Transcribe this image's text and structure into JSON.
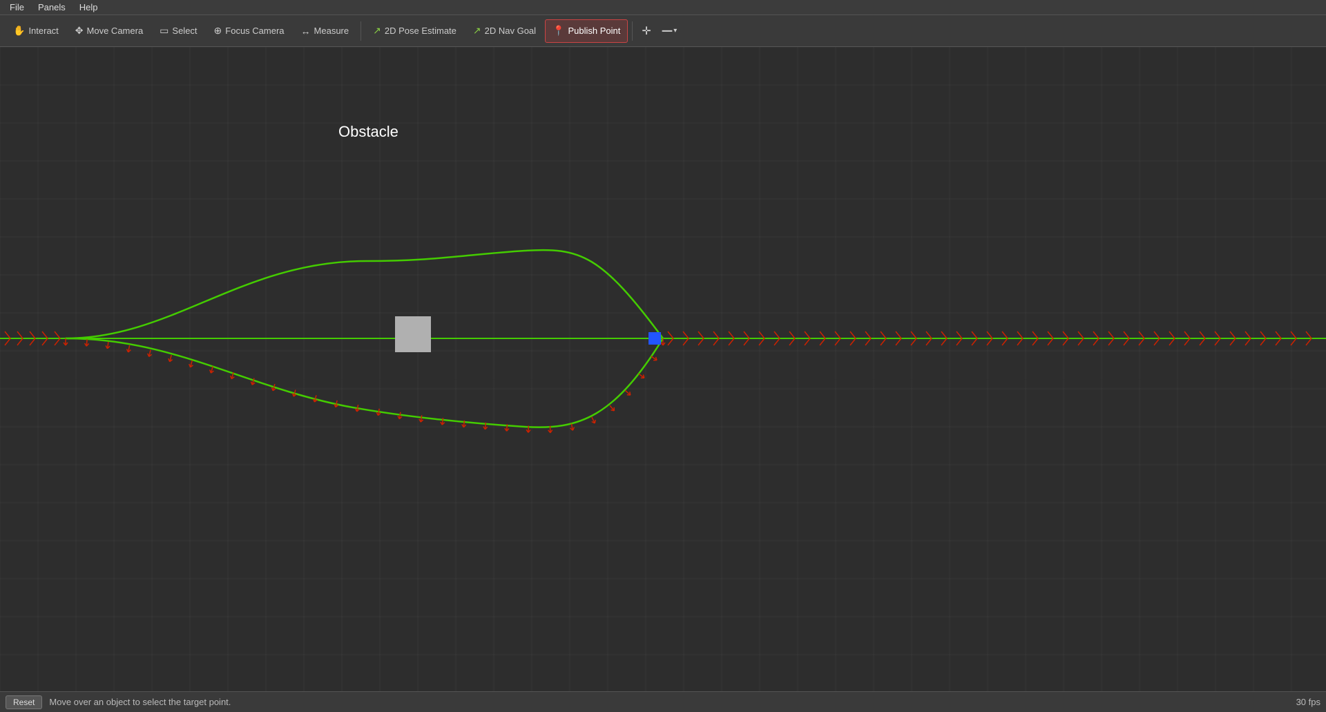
{
  "menubar": {
    "items": [
      {
        "id": "file",
        "label": "File"
      },
      {
        "id": "panels",
        "label": "Panels"
      },
      {
        "id": "help",
        "label": "Help"
      }
    ]
  },
  "toolbar": {
    "tools": [
      {
        "id": "interact",
        "label": "Interact",
        "icon": "✋",
        "active": false
      },
      {
        "id": "move-camera",
        "label": "Move Camera",
        "icon": "✥",
        "active": false
      },
      {
        "id": "select",
        "label": "Select",
        "icon": "▭",
        "active": false
      },
      {
        "id": "focus-camera",
        "label": "Focus Camera",
        "icon": "⊕",
        "active": false
      },
      {
        "id": "measure",
        "label": "Measure",
        "icon": "⟵",
        "active": false
      },
      {
        "id": "2d-pose-estimate",
        "label": "2D Pose Estimate",
        "icon": "↗",
        "active": false
      },
      {
        "id": "2d-nav-goal",
        "label": "2D Nav Goal",
        "icon": "↗",
        "active": false
      },
      {
        "id": "publish-point",
        "label": "Publish Point",
        "icon": "📍",
        "active": true
      }
    ],
    "extra_buttons": [
      {
        "id": "crosshair",
        "icon": "✛"
      },
      {
        "id": "dropdown",
        "icon": "▾"
      }
    ]
  },
  "viewport": {
    "obstacle_label": "Obstacle",
    "grid_color": "#444",
    "grid_spacing": 55
  },
  "statusbar": {
    "reset_label": "Reset",
    "status_text": "Move over an object to select the target point.",
    "fps": "30 fps"
  }
}
